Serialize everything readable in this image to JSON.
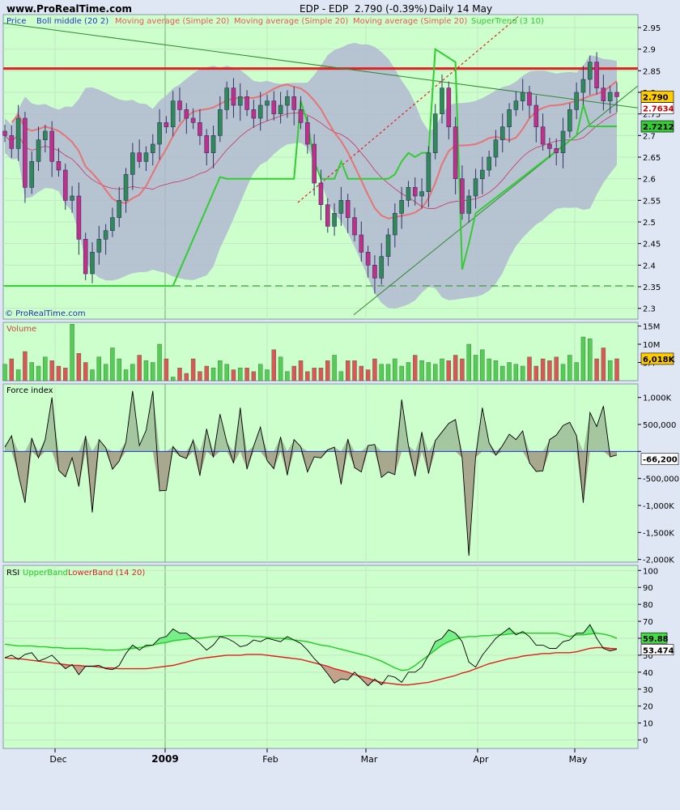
{
  "site": "www.ProRealTime.com",
  "header": {
    "ticker": "EDP - EDP",
    "last": "2.790 (-0.39%)",
    "period": "Daily 14 May"
  },
  "watermark": "© ProRealTime.com",
  "colors": {
    "panel_bg": "#ccffcc",
    "band_fill": "#b2b9d0",
    "candle_up": "#2e8b57",
    "candle_down": "#c0308a",
    "supertrend": "#33cc33",
    "ma": "#ee5555",
    "resistance": "#dd2222",
    "rsi_line": "#000000",
    "rsi_upper": "#22cc22",
    "rsi_lower": "#dd2222",
    "volume_up": "#55cc55",
    "volume_down": "#dd5555",
    "force_fill": "#a5c7a0",
    "force_neg_fill": "#a8a88e"
  },
  "chart_data": [
    {
      "panel": "price",
      "type": "line",
      "legend": [
        "Price",
        "Boll middle (20 2)",
        "Moving average (Simple 20)",
        "Moving average (Simple 20)",
        "Moving average (Simple 20)",
        "SuperTrend (3 10)"
      ],
      "x_ticks": [
        "Dec",
        "2009",
        "Feb",
        "Mar",
        "Apr",
        "May"
      ],
      "y_ticks": [
        2.95,
        2.9,
        2.85,
        2.8,
        2.75,
        2.7,
        2.65,
        2.6,
        2.55,
        2.5,
        2.45,
        2.4,
        2.35,
        2.3
      ],
      "y_tick_labels": [
        "2.95",
        "2.9",
        "2.85",
        "2.8",
        "2.75",
        "2.7",
        "2.65",
        "2.6",
        "2.55",
        "2.5",
        "2.45",
        "2.4",
        "2.35",
        "2.3"
      ],
      "ylim": [
        2.275,
        2.98
      ],
      "close": [
        2.7,
        2.67,
        2.74,
        2.58,
        2.64,
        2.69,
        2.71,
        2.64,
        2.62,
        2.55,
        2.56,
        2.46,
        2.38,
        2.43,
        2.46,
        2.48,
        2.51,
        2.55,
        2.61,
        2.66,
        2.64,
        2.66,
        2.68,
        2.73,
        2.72,
        2.78,
        2.76,
        2.74,
        2.73,
        2.7,
        2.66,
        2.7,
        2.76,
        2.81,
        2.77,
        2.79,
        2.76,
        2.74,
        2.77,
        2.78,
        2.75,
        2.77,
        2.79,
        2.76,
        2.73,
        2.68,
        2.59,
        2.54,
        2.49,
        2.52,
        2.55,
        2.51,
        2.47,
        2.43,
        2.4,
        2.37,
        2.42,
        2.47,
        2.52,
        2.55,
        2.58,
        2.56,
        2.57,
        2.66,
        2.75,
        2.81,
        2.72,
        2.6,
        2.52,
        2.56,
        2.6,
        2.62,
        2.65,
        2.69,
        2.72,
        2.76,
        2.78,
        2.8,
        2.77,
        2.72,
        2.68,
        2.67,
        2.66,
        2.71,
        2.76,
        2.8,
        2.83,
        2.87,
        2.81,
        2.78,
        2.8,
        2.79
      ],
      "resistance_line": 2.855,
      "support_line_dashed": 2.352,
      "last_labels": {
        "price": "2.790",
        "ma": "2.7634",
        "supertrend": "2.7212"
      }
    },
    {
      "panel": "volume",
      "type": "bar",
      "title": "Volume",
      "y_tick_labels": [
        "15M",
        "10M",
        "5M"
      ],
      "ylim": [
        0,
        16
      ],
      "values": [
        4.5,
        6,
        3,
        8,
        5,
        4,
        6.5,
        5.5,
        4,
        3.5,
        15.5,
        7.5,
        5,
        3,
        6.5,
        4.5,
        9,
        6,
        3,
        4.5,
        7,
        5.5,
        5,
        10,
        6,
        1,
        3.5,
        2,
        6,
        2.5,
        4,
        3.5,
        5.5,
        4.5,
        3,
        3.5,
        3.5,
        2.5,
        4.5,
        3,
        8.5,
        6.5,
        2.5,
        4,
        5.5,
        2.5,
        3.5,
        3.5,
        5.5,
        7,
        2.5,
        5.5,
        5.5,
        4,
        3,
        6,
        4.5,
        4.5,
        6,
        4,
        5,
        7,
        5.5,
        5,
        4.5,
        6,
        5.5,
        7,
        6,
        10,
        7,
        8.5,
        6,
        5.5,
        4,
        5,
        4.5,
        4,
        6.5,
        4,
        6,
        5.5,
        6.5,
        4.5,
        7,
        5,
        12,
        11.5,
        6,
        9,
        5.5,
        6.018
      ],
      "last_label": "6,018K"
    },
    {
      "panel": "force",
      "type": "area",
      "title": "Force index",
      "y_ticks": [
        1000000,
        500000,
        0,
        -500000,
        -1000000,
        -1500000,
        -2000000
      ],
      "y_tick_labels": [
        "1,000K",
        "500,000",
        "",
        "-500,000",
        "-1,000K",
        "-1,500K",
        "-2,000K"
      ],
      "ylim": [
        -2050000,
        1250000
      ],
      "values": [
        80000,
        290000,
        -420000,
        -950000,
        250000,
        -120000,
        220000,
        1000000,
        -350000,
        -470000,
        -120000,
        -650000,
        290000,
        -1130000,
        220000,
        70000,
        -330000,
        -180000,
        170000,
        1120000,
        110000,
        390000,
        1120000,
        -730000,
        -720000,
        90000,
        -80000,
        -130000,
        210000,
        -450000,
        420000,
        -110000,
        690000,
        170000,
        -220000,
        810000,
        -330000,
        100000,
        450000,
        -170000,
        -320000,
        270000,
        -440000,
        220000,
        90000,
        -380000,
        -100000,
        -120000,
        30000,
        80000,
        -610000,
        230000,
        -300000,
        -380000,
        110000,
        130000,
        -480000,
        -380000,
        -430000,
        960000,
        110000,
        -460000,
        360000,
        -410000,
        200000,
        360000,
        520000,
        590000,
        -120000,
        -1930000,
        -110000,
        810000,
        160000,
        -70000,
        110000,
        320000,
        220000,
        380000,
        -210000,
        -370000,
        -360000,
        220000,
        300000,
        480000,
        540000,
        290000,
        -950000,
        720000,
        460000,
        840000,
        -100000,
        -66200
      ],
      "last_label": "-66,200"
    },
    {
      "panel": "rsi",
      "type": "line",
      "legend": [
        "RSI",
        "UpperBand",
        "LowerBand (14 20)"
      ],
      "y_ticks": [
        100,
        90,
        80,
        70,
        60,
        50,
        40,
        30,
        20,
        10,
        0
      ],
      "y_tick_labels": [
        "100",
        "90",
        "80",
        "70",
        "60",
        "50",
        "40",
        "30",
        "20",
        "10",
        "0"
      ],
      "ylim": [
        -5,
        103
      ],
      "rsi": [
        48.5,
        50,
        47.5,
        50.5,
        51.5,
        46.5,
        48,
        50,
        46,
        42,
        44.5,
        38.5,
        43.5,
        43.5,
        44,
        42,
        41.5,
        44,
        51,
        56,
        53,
        56,
        56,
        60,
        61,
        65.5,
        63,
        63,
        60,
        57,
        53,
        56,
        61,
        60,
        58,
        55,
        56,
        59,
        58,
        60,
        59,
        58,
        61,
        59,
        57,
        53,
        48,
        44,
        39,
        33.5,
        36,
        35.5,
        40,
        36,
        32,
        36,
        32.5,
        38,
        37,
        34,
        40,
        40,
        43,
        50,
        58,
        60,
        65,
        63,
        58,
        46,
        43,
        50,
        55,
        60,
        63,
        66,
        62,
        64,
        61,
        56,
        56,
        54,
        54,
        58,
        59,
        63,
        63,
        68,
        60,
        54,
        52.5,
        53.474
      ],
      "upper": [
        56.5,
        56,
        55.5,
        55.5,
        55.5,
        55,
        55,
        54.5,
        54.5,
        54,
        54,
        54,
        54,
        53.5,
        53.5,
        53,
        53,
        53,
        53.5,
        54,
        54.5,
        55,
        56,
        57,
        57.5,
        58.5,
        59,
        59.5,
        60,
        60,
        60.5,
        61,
        61,
        61.5,
        61.5,
        61.5,
        61.5,
        61,
        61,
        60.5,
        60,
        60,
        59.5,
        59,
        58.5,
        58,
        57,
        56,
        55.5,
        54.5,
        53.5,
        52.5,
        51.5,
        50.5,
        49.5,
        48,
        46.5,
        44.5,
        42.5,
        41,
        41.5,
        44,
        47,
        50,
        53,
        56,
        58,
        59.5,
        60.5,
        61,
        61,
        61.5,
        61.5,
        62,
        62,
        62.5,
        63,
        63,
        63,
        63,
        63,
        63,
        63,
        62,
        61,
        62,
        62,
        62.5,
        63,
        62.5,
        61.5,
        59.9
      ],
      "lower": [
        48.5,
        48,
        48,
        47.5,
        47,
        46.5,
        46,
        45.5,
        45,
        44.5,
        44,
        44,
        43.5,
        43.5,
        43,
        42.5,
        42.5,
        42,
        42,
        42,
        42,
        42,
        42.5,
        43,
        43.5,
        44,
        45,
        46,
        47,
        48,
        48.5,
        49,
        49.5,
        50,
        50,
        50,
        50.5,
        50.5,
        50.5,
        50,
        49.5,
        49,
        48.5,
        48,
        47.5,
        46.5,
        45.5,
        44.5,
        43.5,
        42,
        41,
        40,
        38.5,
        37.5,
        36.5,
        35,
        34,
        33.5,
        33,
        32.5,
        32.5,
        33,
        33.5,
        34,
        35,
        36,
        37,
        38,
        39.5,
        40.5,
        42,
        43.5,
        45,
        46,
        47,
        48,
        48.5,
        49.5,
        50,
        50.5,
        51,
        51,
        51.5,
        51.5,
        51.5,
        52,
        53,
        54,
        54.5,
        54.5,
        54,
        53.8
      ],
      "last_labels": {
        "upper": "59.88",
        "rsi": "53.474"
      }
    }
  ]
}
